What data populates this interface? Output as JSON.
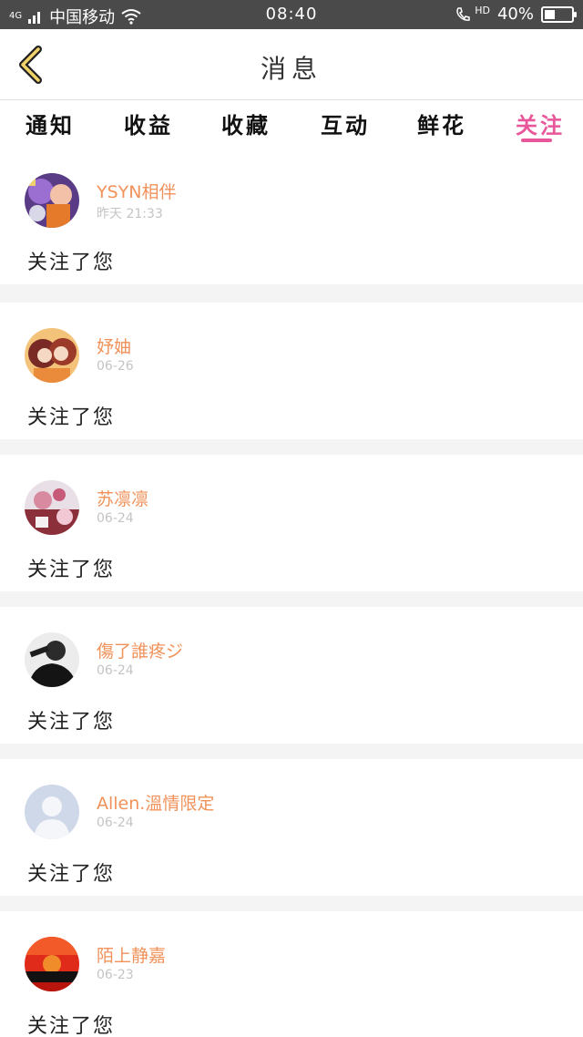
{
  "status_bar": {
    "network": "4G",
    "carrier": "中国移动",
    "time": "08:40",
    "hd": "HD",
    "battery": "40%",
    "battery_level": 0.4
  },
  "header": {
    "title": "消息",
    "back_icon": "chevron-left-icon"
  },
  "tabs": [
    {
      "label": "通知",
      "active": false
    },
    {
      "label": "收益",
      "active": false
    },
    {
      "label": "收藏",
      "active": false
    },
    {
      "label": "互动",
      "active": false
    },
    {
      "label": "鲜花",
      "active": false
    },
    {
      "label": "关注",
      "active": true
    }
  ],
  "colors": {
    "accent": "#e8579a",
    "username": "#f0925a",
    "date": "#c4c4c4",
    "status_bar": "#4a4a4a"
  },
  "notifications": [
    {
      "username": "YSYN相伴",
      "date": "昨天 21:33",
      "action": "关注了您"
    },
    {
      "username": "妤妯",
      "date": "06-26",
      "action": "关注了您"
    },
    {
      "username": "苏凛凛",
      "date": "06-24",
      "action": "关注了您"
    },
    {
      "username": "傷了誰疼ジ",
      "date": "06-24",
      "action": "关注了您"
    },
    {
      "username": "Allen.溫情限定",
      "date": "06-24",
      "action": "关注了您"
    },
    {
      "username": "陌上静嘉",
      "date": "06-23",
      "action": "关注了您"
    }
  ]
}
